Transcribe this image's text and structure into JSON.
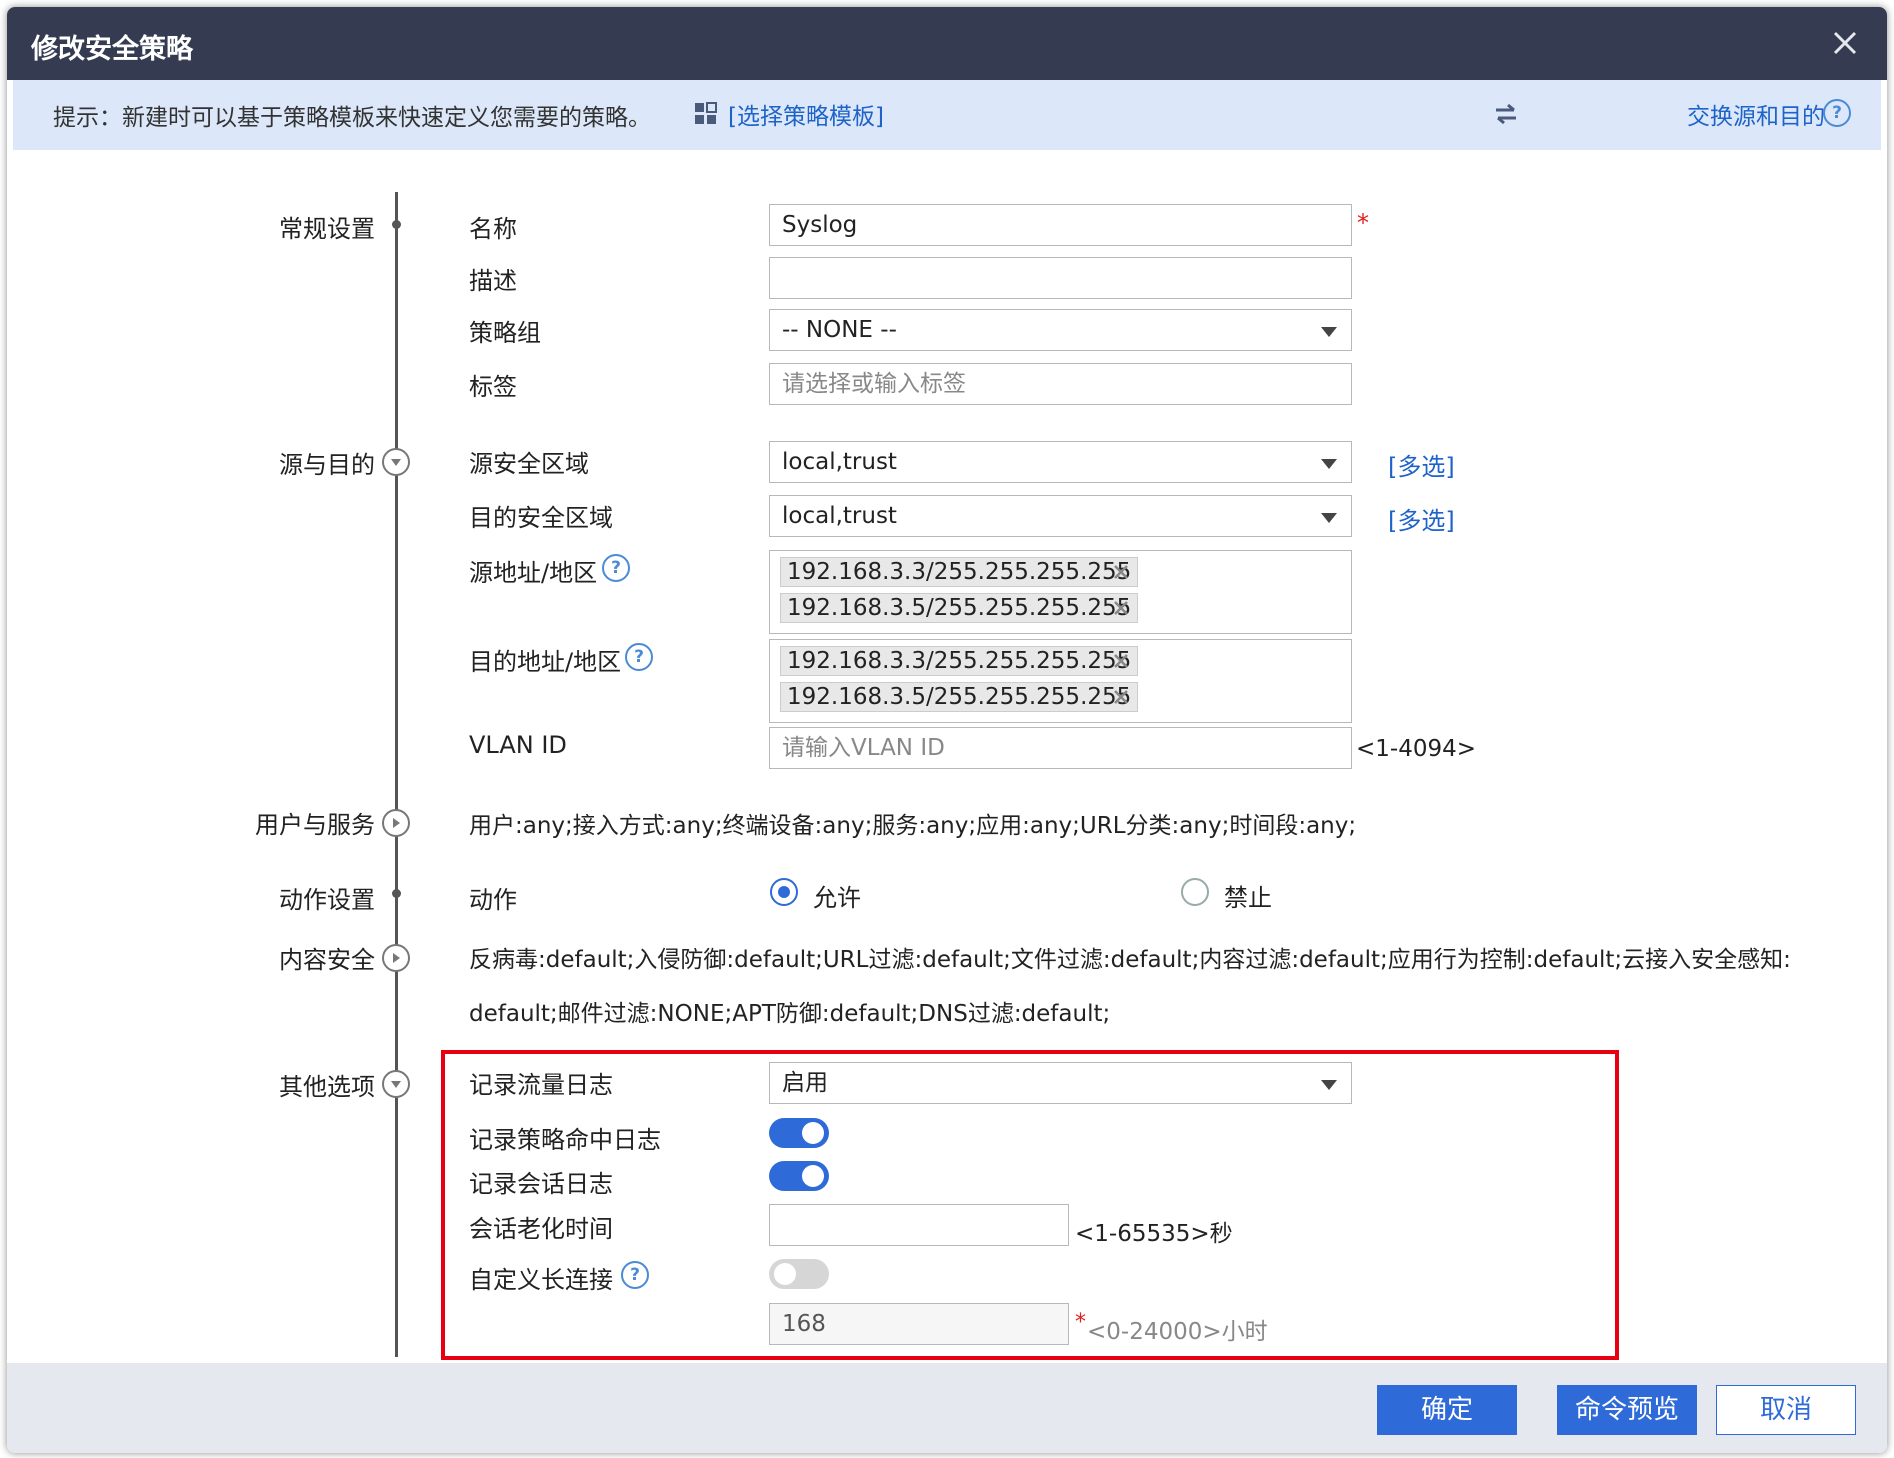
{
  "dialog": {
    "title": "修改安全策略"
  },
  "hint": {
    "text": "提示：新建时可以基于策略模板来快速定义您需要的策略。",
    "template_link": "[选择策略模板]",
    "swap_link": "交换源和目的"
  },
  "sections": {
    "general": "常规设置",
    "src_dst": "源与目的",
    "user_service": "用户与服务",
    "action": "动作设置",
    "content_security": "内容安全",
    "other": "其他选项"
  },
  "general": {
    "name_label": "名称",
    "name_value": "Syslog",
    "desc_label": "描述",
    "desc_value": "",
    "group_label": "策略组",
    "group_value": "-- NONE --",
    "tag_label": "标签",
    "tag_placeholder": "请选择或输入标签"
  },
  "src_dst": {
    "src_zone_label": "源安全区域",
    "src_zone_value": "local,trust",
    "dst_zone_label": "目的安全区域",
    "dst_zone_value": "local,trust",
    "multi_select": "[多选]",
    "src_addr_label": "源地址/地区",
    "src_addrs": [
      "192.168.3.3/255.255.255.255",
      "192.168.3.5/255.255.255.255"
    ],
    "dst_addr_label": "目的地址/地区",
    "dst_addrs": [
      "192.168.3.3/255.255.255.255",
      "192.168.3.5/255.255.255.255"
    ],
    "vlan_label": "VLAN ID",
    "vlan_placeholder": "请输入VLAN ID",
    "vlan_hint": "<1-4094>"
  },
  "user_service": {
    "summary": "用户:any;接入方式:any;终端设备:any;服务:any;应用:any;URL分类:any;时间段:any;"
  },
  "action": {
    "label": "动作",
    "allow": "允许",
    "deny": "禁止",
    "selected": "allow"
  },
  "content_security": {
    "line1": "反病毒:default;入侵防御:default;URL过滤:default;文件过滤:default;内容过滤:default;应用行为控制:default;云接入安全感知:",
    "line2": "default;邮件过滤:NONE;APT防御:default;DNS过滤:default;"
  },
  "other": {
    "traffic_log_label": "记录流量日志",
    "traffic_log_value": "启用",
    "hit_log_label": "记录策略命中日志",
    "hit_log_on": true,
    "session_log_label": "记录会话日志",
    "session_log_on": true,
    "aging_label": "会话老化时间",
    "aging_value": "",
    "aging_hint": "<1-65535>秒",
    "long_conn_label": "自定义长连接",
    "long_conn_on": false,
    "long_conn_value": "168",
    "long_conn_required_mark": "*",
    "long_conn_hint": "<0-24000>小时"
  },
  "footer": {
    "ok": "确定",
    "preview": "命令预览",
    "cancel": "取消"
  },
  "colors": {
    "titlebar": "#353c52",
    "hintbar": "#dce8f9",
    "link": "#1e63c9",
    "accent": "#2f6bd8",
    "highlight_box": "#e60012",
    "footer": "#e5e8ee"
  }
}
